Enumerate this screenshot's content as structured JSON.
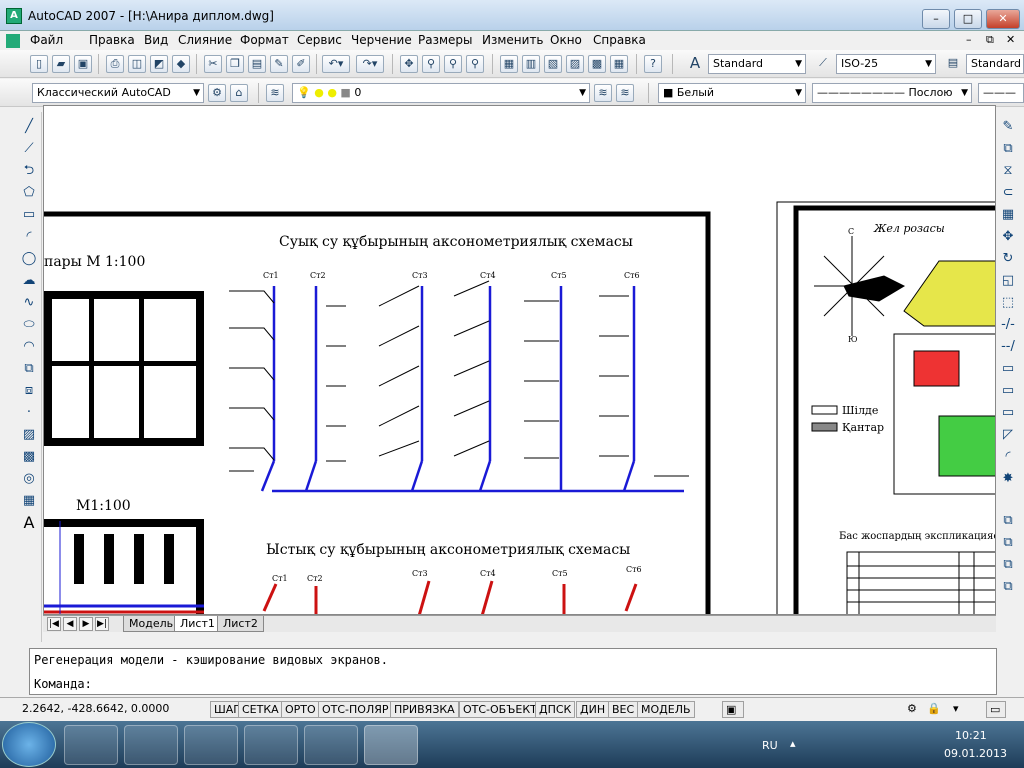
{
  "window": {
    "title": "AutoCAD 2007 - [H:\\Анира диплом.dwg]",
    "minimize": "–",
    "maximize": "□",
    "close": "✕"
  },
  "menu": [
    "Файл",
    "Правка",
    "Вид",
    "Слияние",
    "Формат",
    "Сервис",
    "Черчение",
    "Размеры",
    "Изменить",
    "Окно",
    "Справка"
  ],
  "toolbar1": {
    "text_style": "Standard",
    "dim_style": "ISO-25",
    "table_style": "Standard"
  },
  "toolbar2": {
    "workspace": "Классический AutoCAD",
    "layer": "0",
    "color": "Белый",
    "linetype": "Послою"
  },
  "drawing": {
    "left_title1": "пары    М 1:100",
    "left_title2": "М1:100",
    "cold_title": "Суық  су құбырының  аксонометриялық  схемасы",
    "hot_title": "Ыстық  су құбырының  аксонометриялық  схемасы",
    "risers": [
      "Ст1",
      "Ст2",
      "Ст3",
      "Ст4",
      "Ст5",
      "Ст6"
    ],
    "wind_title": "Жел розасы",
    "compass_n": "С",
    "compass_s": "Ю",
    "legend_fence": "Шілде",
    "legend_wall": "Қантар",
    "explication_title": "Бас жоспардың экспликациясы",
    "colors": {
      "cold": "#1a1ad6",
      "hot": "#cc1111",
      "green": "#22cc22",
      "yellow": "#e6e64a"
    }
  },
  "tabs": {
    "model": "Модель",
    "sheet1": "Лист1",
    "sheet2": "Лист2"
  },
  "command": {
    "line1": "Регенерация модели - кэширование видовых экранов.",
    "line2": "Команда:"
  },
  "status": {
    "coords": "2.2642,  -428.6642, 0.0000",
    "buttons": [
      "ШАГ",
      "СЕТКА",
      "ОРТО",
      "ОТС-ПОЛЯР",
      "ПРИВЯЗКА",
      "ОТС-ОБЪЕКТ",
      "ДПСК",
      "ДИН",
      "ВЕС",
      "МОДЕЛЬ"
    ]
  },
  "taskbar": {
    "lang": "RU",
    "time": "10:21",
    "date": "09.01.2013"
  }
}
